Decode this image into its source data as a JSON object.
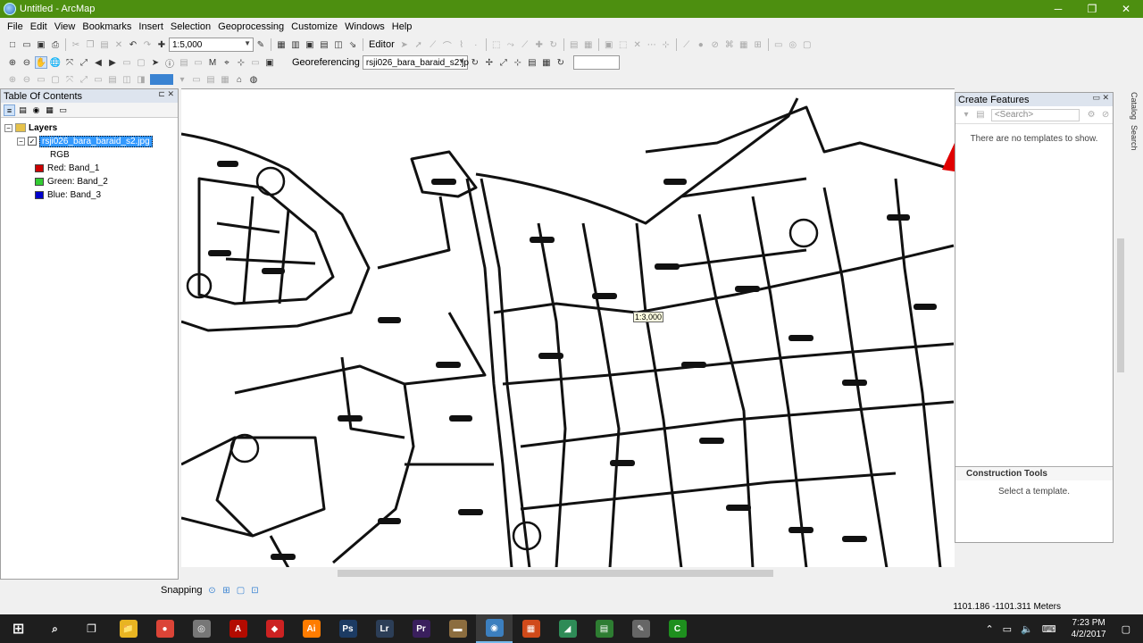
{
  "window": {
    "title": "Untitled - ArcMap",
    "controls": [
      "─",
      "❐",
      "✕"
    ]
  },
  "menu": [
    "File",
    "Edit",
    "View",
    "Bookmarks",
    "Insert",
    "Selection",
    "Geoprocessing",
    "Customize",
    "Windows",
    "Help"
  ],
  "toolbar": {
    "scale_value": "1:5,000",
    "editor_label": "Editor",
    "georef_label": "Georeferencing",
    "georef_layer": "rsji026_bara_baraid_s2.jp"
  },
  "toc": {
    "title": "Table Of Contents",
    "root_label": "Layers",
    "layer_name": "rsji026_bara_baraid_s2.jpg",
    "rgb_label": "RGB",
    "bands": [
      {
        "label": "Red:   Band_1",
        "color": "#cc0000"
      },
      {
        "label": "Green: Band_2",
        "color": "#33cc33"
      },
      {
        "label": "Blue:  Band_3",
        "color": "#0000cc"
      }
    ]
  },
  "map": {
    "scale_tip": "1:3,000"
  },
  "create_features": {
    "title": "Create Features",
    "search_placeholder": "<Search>",
    "empty_msg": "There are no templates to show.",
    "construction_title": "Construction Tools",
    "construction_msg": "Select a template."
  },
  "side_tabs": [
    "Catalog",
    "Search"
  ],
  "snapping": {
    "label": "Snapping"
  },
  "status": {
    "coords": "1101.186  -1101.311 Meters"
  },
  "taskbar": {
    "apps": [
      {
        "name": "file-explorer",
        "glyph": "📁",
        "bg": "#e8b422"
      },
      {
        "name": "chrome",
        "glyph": "●",
        "bg": "#db4437"
      },
      {
        "name": "app-3",
        "glyph": "◎",
        "bg": "#777777"
      },
      {
        "name": "acrobat",
        "glyph": "A",
        "bg": "#b30b00"
      },
      {
        "name": "app-5",
        "glyph": "◆",
        "bg": "#cc2222"
      },
      {
        "name": "illustrator",
        "glyph": "Ai",
        "bg": "#ff7c00"
      },
      {
        "name": "photoshop",
        "glyph": "Ps",
        "bg": "#1c3b63"
      },
      {
        "name": "lightroom",
        "glyph": "Lr",
        "bg": "#2c3e57"
      },
      {
        "name": "premiere",
        "glyph": "Pr",
        "bg": "#3a1f5d"
      },
      {
        "name": "app-10",
        "glyph": "▬",
        "bg": "#8c6d3f"
      },
      {
        "name": "arcmap",
        "glyph": "◉",
        "bg": "#3c7fbf"
      },
      {
        "name": "app-12",
        "glyph": "▦",
        "bg": "#d04a1a"
      },
      {
        "name": "app-13",
        "glyph": "◢",
        "bg": "#2e8b57"
      },
      {
        "name": "app-14",
        "glyph": "▤",
        "bg": "#2e7d32"
      },
      {
        "name": "app-15",
        "glyph": "✎",
        "bg": "#666666"
      },
      {
        "name": "app-16",
        "glyph": "C",
        "bg": "#1e8f1e"
      }
    ],
    "time": "7:23 PM",
    "date": "4/2/2017"
  }
}
